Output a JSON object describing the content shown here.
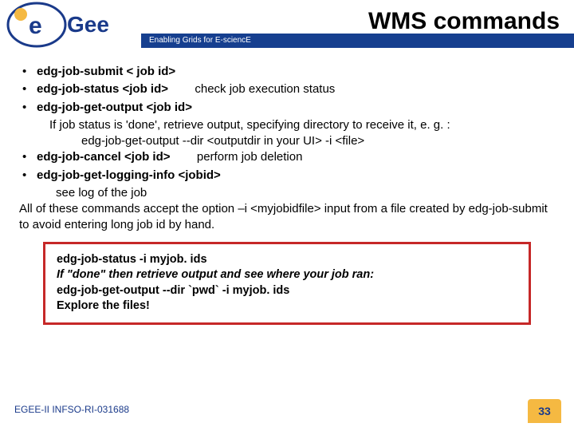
{
  "header": {
    "title": "WMS commands",
    "tagline": "Enabling Grids for E-sciencE",
    "logo_text_e": "e",
    "logo_text_gee": "Gee"
  },
  "bullets": [
    {
      "cmd": "edg-job-submit  < job id>",
      "desc": ""
    },
    {
      "cmd": "edg-job-status  <job id>",
      "desc": "check job execution status"
    },
    {
      "cmd": "edg-job-get-output  <job id>",
      "desc": "",
      "sub1": "If job status is 'done', retrieve output, specifying directory to receive it, e. g. :",
      "sub2": "edg-job-get-output --dir <outputdir in your UI> -i <file>"
    },
    {
      "cmd": "edg-job-cancel  <job id>",
      "desc": "perform job deletion"
    },
    {
      "cmd": "edg-job-get-logging-info <jobid>",
      "desc": "",
      "sub1": "see log of the job"
    }
  ],
  "tail": "All of these commands accept the option –i <myjobidfile> input from a file created by edg-job-submit to avoid entering long job id by hand.",
  "box": {
    "l1": "edg-job-status  -i myjob. ids",
    "l2": "If \"done\" then retrieve output and see where your job ran:",
    "l3": "edg-job-get-output --dir `pwd`  -i myjob. ids",
    "l4": "Explore the files!"
  },
  "footer": {
    "left": "EGEE-II INFSO-RI-031688",
    "page": "33"
  }
}
